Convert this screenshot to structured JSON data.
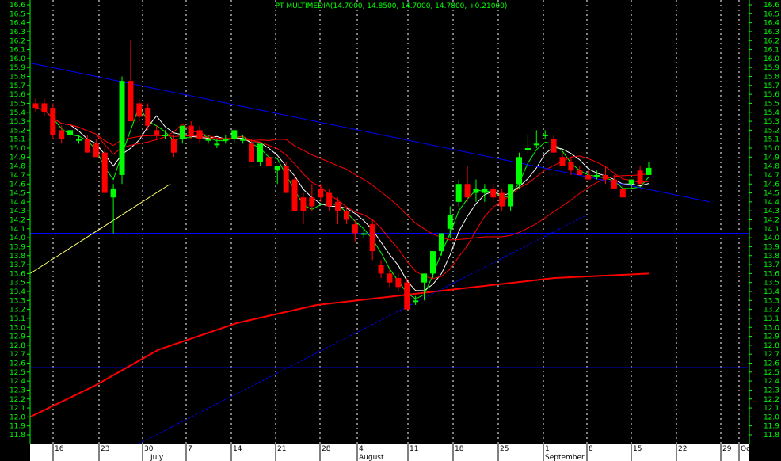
{
  "chart_data": {
    "type": "candlestick",
    "title": "PT MULTIMEDIA(14.7000, 14.8500, 14.7000, 14.7800, +0.21000)",
    "ylim": [
      11.7,
      16.7
    ],
    "y_ticks": [
      16.6,
      16.5,
      16.4,
      16.3,
      16.2,
      16.1,
      16.0,
      15.9,
      15.8,
      15.7,
      15.6,
      15.5,
      15.4,
      15.3,
      15.2,
      15.1,
      15.0,
      14.9,
      14.8,
      14.7,
      14.6,
      14.5,
      14.4,
      14.3,
      14.2,
      14.1,
      14.0,
      13.9,
      13.8,
      13.7,
      13.6,
      13.5,
      13.4,
      13.3,
      13.2,
      13.1,
      13.0,
      12.9,
      12.8,
      12.7,
      12.6,
      12.5,
      12.4,
      12.3,
      12.2,
      12.1,
      12.0,
      11.9,
      11.8
    ],
    "day_labels": [
      "16",
      "23",
      "30",
      "7",
      "14",
      "21",
      "28",
      "4",
      "11",
      "18",
      "25",
      "1",
      "8",
      "15",
      "22",
      "29",
      "Oct"
    ],
    "month_labels": [
      "July",
      "August",
      "September"
    ],
    "grid": "vertical-dotted",
    "colors": {
      "background": "#000000",
      "axis_text": "#00ff00",
      "up": "#00ff00",
      "down": "#ff0000",
      "trendline": "#0000ff",
      "ma_short": "#ffffff",
      "ma_medium": "#00ff00",
      "ma_long": "#ff0000",
      "ma_200": "#ff0000",
      "support_line": "#ffff66"
    },
    "horizontal_lines": [
      14.05,
      12.55
    ],
    "candles": [
      {
        "o": 15.5,
        "h": 15.55,
        "l": 15.4,
        "c": 15.45
      },
      {
        "o": 15.5,
        "h": 15.55,
        "l": 15.35,
        "c": 15.4
      },
      {
        "o": 15.45,
        "h": 15.5,
        "l": 15.1,
        "c": 15.15
      },
      {
        "o": 15.2,
        "h": 15.25,
        "l": 15.05,
        "c": 15.1
      },
      {
        "o": 15.15,
        "h": 15.2,
        "l": 15.1,
        "c": 15.2
      },
      {
        "o": 15.1,
        "h": 15.15,
        "l": 15.05,
        "c": 15.1
      },
      {
        "o": 15.1,
        "h": 15.15,
        "l": 14.95,
        "c": 14.95
      },
      {
        "o": 15.05,
        "h": 15.1,
        "l": 14.9,
        "c": 14.9
      },
      {
        "o": 14.95,
        "h": 15.0,
        "l": 14.5,
        "c": 14.5
      },
      {
        "o": 14.45,
        "h": 14.6,
        "l": 14.05,
        "c": 14.55
      },
      {
        "o": 14.7,
        "h": 15.8,
        "l": 14.6,
        "c": 15.75
      },
      {
        "o": 15.75,
        "h": 16.2,
        "l": 15.3,
        "c": 15.3
      },
      {
        "o": 15.5,
        "h": 15.55,
        "l": 15.3,
        "c": 15.35
      },
      {
        "o": 15.45,
        "h": 15.5,
        "l": 15.2,
        "c": 15.25
      },
      {
        "o": 15.2,
        "h": 15.25,
        "l": 15.1,
        "c": 15.15
      },
      {
        "o": 15.15,
        "h": 15.2,
        "l": 15.1,
        "c": 15.15
      },
      {
        "o": 15.1,
        "h": 15.15,
        "l": 14.9,
        "c": 14.95
      },
      {
        "o": 15.1,
        "h": 15.25,
        "l": 15.05,
        "c": 15.25
      },
      {
        "o": 15.25,
        "h": 15.3,
        "l": 15.1,
        "c": 15.15
      },
      {
        "o": 15.2,
        "h": 15.25,
        "l": 15.05,
        "c": 15.1
      },
      {
        "o": 15.1,
        "h": 15.15,
        "l": 15.05,
        "c": 15.1
      },
      {
        "o": 15.05,
        "h": 15.1,
        "l": 15.0,
        "c": 15.05
      },
      {
        "o": 15.1,
        "h": 15.15,
        "l": 15.05,
        "c": 15.1
      },
      {
        "o": 15.1,
        "h": 15.2,
        "l": 15.05,
        "c": 15.2
      },
      {
        "o": 15.1,
        "h": 15.15,
        "l": 15.05,
        "c": 15.1
      },
      {
        "o": 15.05,
        "h": 15.1,
        "l": 14.85,
        "c": 14.85
      },
      {
        "o": 14.85,
        "h": 15.05,
        "l": 14.8,
        "c": 15.05
      },
      {
        "o": 14.9,
        "h": 14.95,
        "l": 14.8,
        "c": 14.8
      },
      {
        "o": 14.75,
        "h": 14.8,
        "l": 14.6,
        "c": 14.8
      },
      {
        "o": 14.8,
        "h": 14.85,
        "l": 14.5,
        "c": 14.5
      },
      {
        "o": 14.65,
        "h": 14.7,
        "l": 14.3,
        "c": 14.3
      },
      {
        "o": 14.45,
        "h": 14.5,
        "l": 14.15,
        "c": 14.3
      },
      {
        "o": 14.45,
        "h": 14.6,
        "l": 14.3,
        "c": 14.35
      },
      {
        "o": 14.55,
        "h": 14.6,
        "l": 14.4,
        "c": 14.45
      },
      {
        "o": 14.5,
        "h": 14.55,
        "l": 14.3,
        "c": 14.35
      },
      {
        "o": 14.4,
        "h": 14.45,
        "l": 14.15,
        "c": 14.3
      },
      {
        "o": 14.3,
        "h": 14.35,
        "l": 14.15,
        "c": 14.2
      },
      {
        "o": 14.15,
        "h": 14.2,
        "l": 13.95,
        "c": 14.05
      },
      {
        "o": 14.05,
        "h": 14.1,
        "l": 14.0,
        "c": 14.05
      },
      {
        "o": 14.15,
        "h": 14.2,
        "l": 13.75,
        "c": 13.85
      },
      {
        "o": 13.7,
        "h": 13.75,
        "l": 13.55,
        "c": 13.6
      },
      {
        "o": 13.6,
        "h": 13.65,
        "l": 13.45,
        "c": 13.5
      },
      {
        "o": 13.55,
        "h": 13.6,
        "l": 13.4,
        "c": 13.45
      },
      {
        "o": 13.5,
        "h": 13.55,
        "l": 13.2,
        "c": 13.2
      },
      {
        "o": 13.3,
        "h": 13.35,
        "l": 13.25,
        "c": 13.3
      },
      {
        "o": 13.5,
        "h": 13.6,
        "l": 13.3,
        "c": 13.6
      },
      {
        "o": 13.6,
        "h": 13.85,
        "l": 13.55,
        "c": 13.85
      },
      {
        "o": 13.85,
        "h": 14.05,
        "l": 13.8,
        "c": 14.05
      },
      {
        "o": 14.1,
        "h": 14.35,
        "l": 14.0,
        "c": 14.25
      },
      {
        "o": 14.4,
        "h": 14.65,
        "l": 14.35,
        "c": 14.6
      },
      {
        "o": 14.6,
        "h": 14.8,
        "l": 14.4,
        "c": 14.45
      },
      {
        "o": 14.5,
        "h": 14.65,
        "l": 14.4,
        "c": 14.55
      },
      {
        "o": 14.5,
        "h": 14.6,
        "l": 14.4,
        "c": 14.55
      },
      {
        "o": 14.55,
        "h": 14.6,
        "l": 14.4,
        "c": 14.45
      },
      {
        "o": 14.5,
        "h": 14.55,
        "l": 14.3,
        "c": 14.35
      },
      {
        "o": 14.35,
        "h": 14.6,
        "l": 14.3,
        "c": 14.6
      },
      {
        "o": 14.6,
        "h": 14.95,
        "l": 14.55,
        "c": 14.9
      },
      {
        "o": 15.0,
        "h": 15.15,
        "l": 14.95,
        "c": 15.0
      },
      {
        "o": 15.05,
        "h": 15.2,
        "l": 15.0,
        "c": 15.05
      },
      {
        "o": 15.15,
        "h": 15.2,
        "l": 15.1,
        "c": 15.15
      },
      {
        "o": 15.1,
        "h": 15.15,
        "l": 14.95,
        "c": 14.95
      },
      {
        "o": 14.9,
        "h": 14.95,
        "l": 14.8,
        "c": 14.8
      },
      {
        "o": 14.85,
        "h": 14.9,
        "l": 14.7,
        "c": 14.75
      },
      {
        "o": 14.75,
        "h": 14.8,
        "l": 14.7,
        "c": 14.7
      },
      {
        "o": 14.7,
        "h": 14.75,
        "l": 14.65,
        "c": 14.65
      },
      {
        "o": 14.7,
        "h": 14.75,
        "l": 14.65,
        "c": 14.7
      },
      {
        "o": 14.7,
        "h": 14.8,
        "l": 14.6,
        "c": 14.65
      },
      {
        "o": 14.65,
        "h": 14.7,
        "l": 14.55,
        "c": 14.55
      },
      {
        "o": 14.55,
        "h": 14.6,
        "l": 14.45,
        "c": 14.45
      },
      {
        "o": 14.6,
        "h": 14.65,
        "l": 14.55,
        "c": 14.65
      },
      {
        "o": 14.75,
        "h": 14.8,
        "l": 14.6,
        "c": 14.6
      },
      {
        "o": 14.7,
        "h": 14.85,
        "l": 14.7,
        "c": 14.78
      }
    ]
  }
}
